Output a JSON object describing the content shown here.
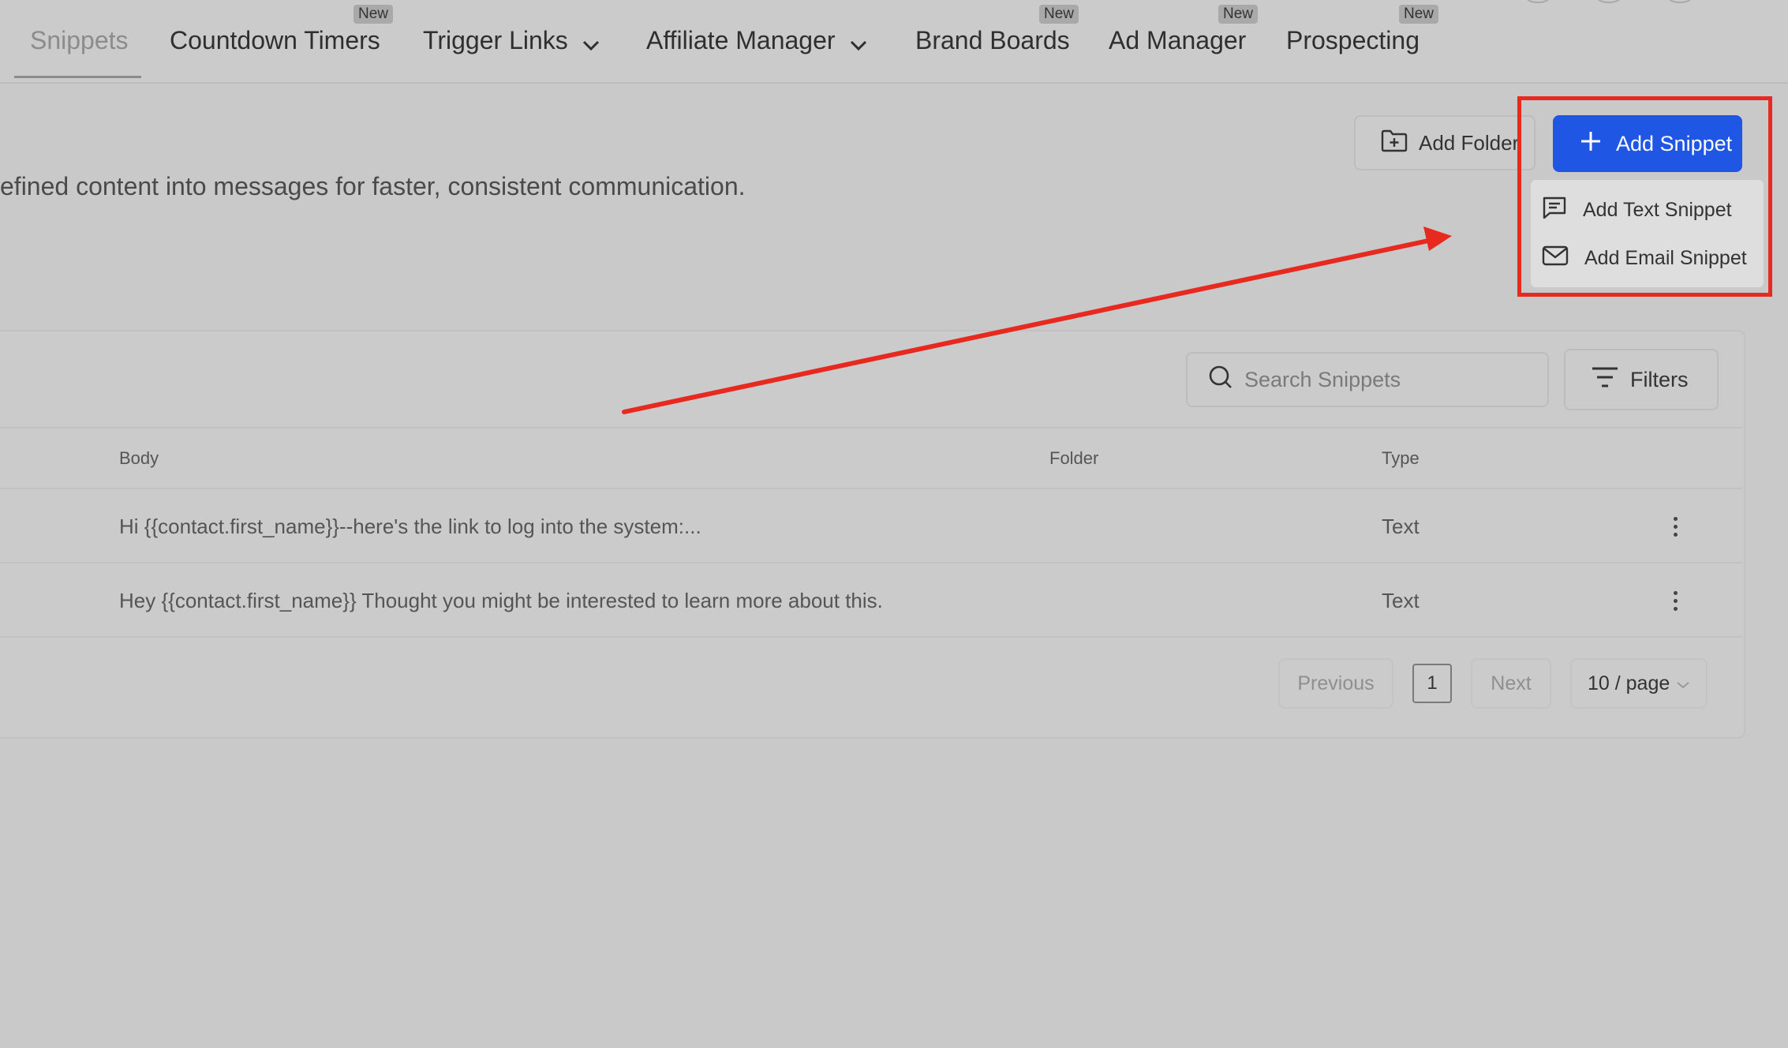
{
  "tabs": [
    {
      "label": "Snippets",
      "active": true,
      "badge": ""
    },
    {
      "label": "Countdown Timers",
      "badge": "New"
    },
    {
      "label": "Trigger Links",
      "badge": "",
      "has_dropdown": true
    },
    {
      "label": "Affiliate Manager",
      "badge": "",
      "has_dropdown": true
    },
    {
      "label": "Brand Boards",
      "badge": "New"
    },
    {
      "label": "Ad Manager",
      "badge": "New"
    },
    {
      "label": "Prospecting",
      "badge": "New"
    }
  ],
  "page": {
    "description": "efined content into messages for faster, consistent communication."
  },
  "actions": {
    "add_folder": "Add Folder",
    "add_snippet": "Add Snippet"
  },
  "dropdown": {
    "items": [
      {
        "label": "Add Text Snippet",
        "icon": "message-icon"
      },
      {
        "label": "Add Email Snippet",
        "icon": "mail-icon"
      }
    ]
  },
  "toolbar": {
    "search_placeholder": "Search Snippets",
    "filters_label": "Filters"
  },
  "table": {
    "columns": [
      "Body",
      "Folder",
      "Type"
    ],
    "rows": [
      {
        "body": "Hi {{contact.first_name}}--here's the link to log into the system:...",
        "folder": "",
        "type": "Text"
      },
      {
        "body": "Hey {{contact.first_name}} Thought you might be interested to learn more about this.",
        "folder": "",
        "type": "Text"
      }
    ]
  },
  "pagination": {
    "previous": "Previous",
    "current_page": "1",
    "next": "Next",
    "page_size": "10 / page"
  },
  "colors": {
    "primary": "#1f56e3",
    "annotation_red": "#e8291f",
    "background": "#c9c9c9"
  }
}
